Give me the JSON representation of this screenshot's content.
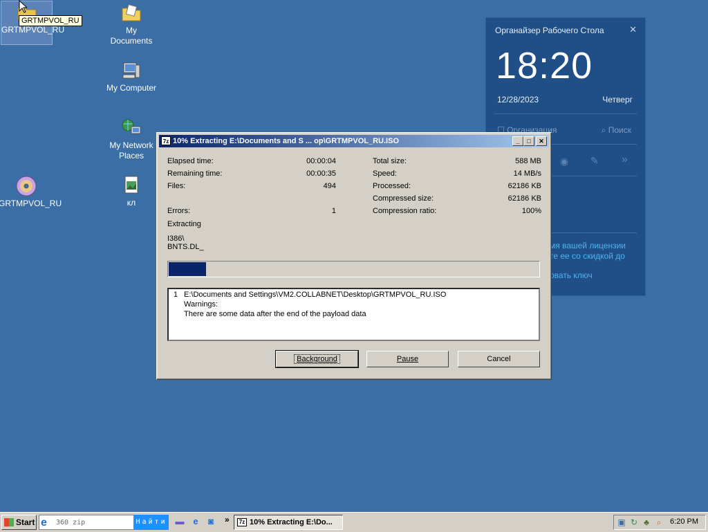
{
  "desktop": {
    "icons": [
      {
        "label": "GRTMPVOL_RU",
        "icon": "folder-icon"
      },
      {
        "label": "My Documents",
        "icon": "documents-folder-icon"
      },
      {
        "label": "My Computer",
        "icon": "computer-icon"
      },
      {
        "label": "My Network Places",
        "icon": "network-places-icon"
      },
      {
        "label": "GRTMPVOL_RU",
        "icon": "cd-disc-icon"
      },
      {
        "label": "кл",
        "icon": "image-file-icon"
      }
    ],
    "tooltip": "GRTMPVOL_RU"
  },
  "widget": {
    "title": "Органайзер Рабочего Стола",
    "time": "18:20",
    "date": "12/28/2023",
    "weekday": "Четверг",
    "org_label": "Организация",
    "search_label": "Поиск",
    "promo_line1": "мя вашей лицензии",
    "promo_line2": "те ее со скидкой до",
    "promo_line3": "овать ключ"
  },
  "dialog": {
    "title": "10% Extracting E:\\Documents and S ... op\\GRTMPVOL_RU.ISO",
    "elapsed_label": "Elapsed time:",
    "elapsed": "00:00:04",
    "remaining_label": "Remaining time:",
    "remaining": "00:00:35",
    "files_label": "Files:",
    "files": "494",
    "errors_label": "Errors:",
    "errors": "1",
    "total_label": "Total size:",
    "total": "588 MB",
    "speed_label": "Speed:",
    "speed": "14 MB/s",
    "processed_label": "Processed:",
    "processed": "62186 KB",
    "compressed_label": "Compressed size:",
    "compressed": "62186 KB",
    "ratio_label": "Compression ratio:",
    "ratio": "100%",
    "extracting_label": "Extracting",
    "current_dir": "I386\\",
    "current_file": "BNTS.DL_",
    "progress": 0.1,
    "messages": {
      "index": "1",
      "path": "E:\\Documents and Settings\\VM2.COLLABNET\\Desktop\\GRTMPVOL_RU.ISO",
      "warn_title": "Warnings:",
      "warn_text": "There are some data after the end of the payload data"
    },
    "buttons": {
      "background": "Background",
      "pause": "Pause",
      "cancel": "Cancel"
    }
  },
  "taskbar": {
    "start": "Start",
    "address_text": "360 zip",
    "find": "Найти",
    "task_item": "10% Extracting E:\\Do...",
    "clock": "6:20 PM",
    "chevron": "»"
  },
  "colors": {
    "desktop": "#3a6ea5",
    "widget": "#1f4f86",
    "title_active": "#0a246a",
    "progress": "#0a246a"
  }
}
